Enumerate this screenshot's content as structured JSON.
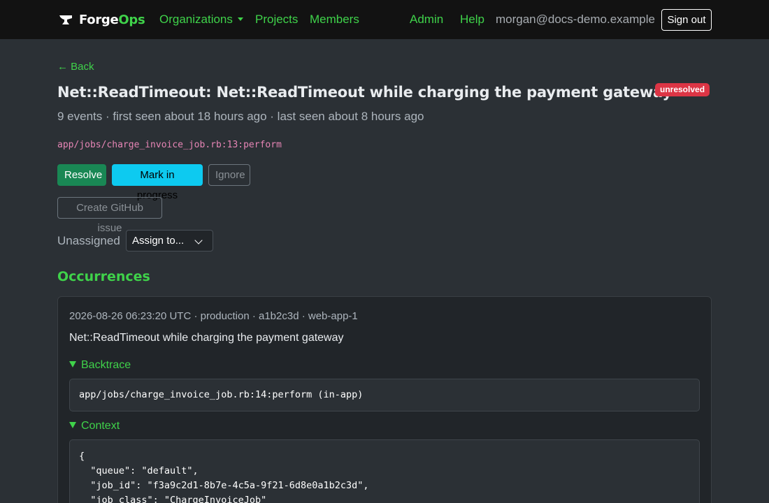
{
  "navbar": {
    "brand_main": "Forge",
    "brand_accent": "Ops",
    "links": {
      "organizations": "Organizations",
      "projects": "Projects",
      "members": "Members",
      "admin": "Admin",
      "help": "Help"
    },
    "user_email": "morgan@docs-demo.example",
    "signout_label": "Sign out",
    "accent_color": "#3fd24a"
  },
  "issue": {
    "back_label": "← Back",
    "title": "Net::ReadTimeout: Net::ReadTimeout while charging the payment gateway",
    "status_badge": "unresolved",
    "meta": "9 events · first seen about 18 hours ago · last seen about 8 hours ago",
    "location": "app/jobs/charge_invoice_job.rb:13:perform",
    "actions": {
      "resolve": "Resolve",
      "mark_in_progress": "Mark in progress",
      "ignore": "Ignore",
      "create_github_issue": "Create GitHub issue"
    },
    "assignment": {
      "label": "Unassigned",
      "select_value": "Assign to..."
    }
  },
  "occurrences": {
    "heading": "Occurrences",
    "items": [
      {
        "meta": "2026-08-26 06:23:20 UTC · production · a1b2c3d · web-app-1",
        "message": "Net::ReadTimeout while charging the payment gateway",
        "backtrace_label": "Backtrace",
        "backtrace": "app/jobs/charge_invoice_job.rb:14:perform (in-app)",
        "context_label": "Context",
        "context_lines": [
          "{",
          "  \"queue\": \"default\",",
          "  \"job_id\": \"f3a9c2d1-8b7e-4c5a-9f21-6d8e0a1b2c3d\",",
          "  \"job_class\": \"ChargeInvoiceJob\""
        ]
      }
    ]
  }
}
